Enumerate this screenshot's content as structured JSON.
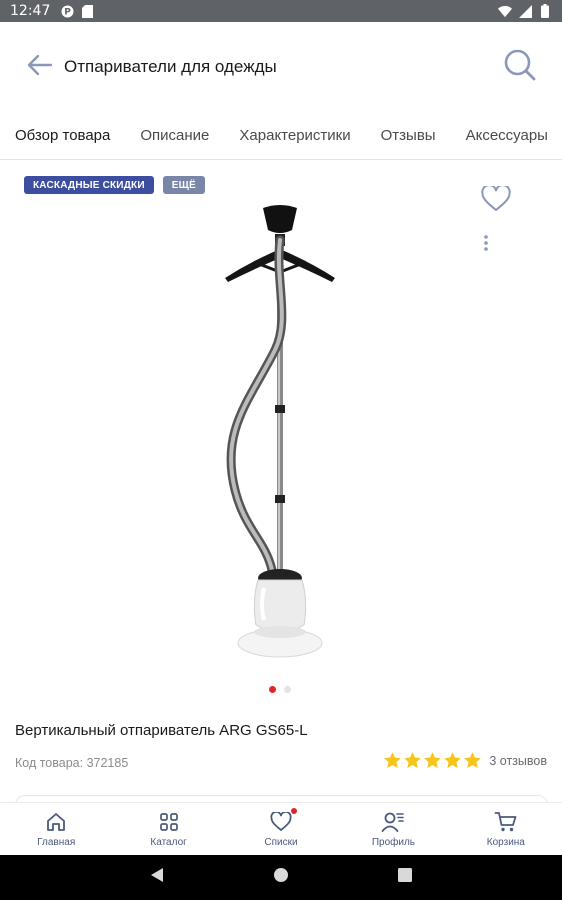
{
  "status_bar": {
    "time": "12:47",
    "icons_left": [
      "p-logo-icon",
      "sd-card-icon"
    ],
    "icons_right": [
      "wifi-icon",
      "signal-icon",
      "battery-icon"
    ]
  },
  "app_bar": {
    "title": "Отпариватели для одежды",
    "back_icon": "arrow-left-icon",
    "search_icon": "search-icon"
  },
  "tabs": [
    {
      "label": "Обзор товара",
      "active": true
    },
    {
      "label": "Описание",
      "active": false
    },
    {
      "label": "Характеристики",
      "active": false
    },
    {
      "label": "Отзывы",
      "active": false
    },
    {
      "label": "Аксессуары",
      "active": false
    }
  ],
  "badges": [
    {
      "label": "КАСКАДНЫЕ СКИДКИ"
    },
    {
      "label": "ЕЩЁ"
    }
  ],
  "gallery": {
    "current_index": 1,
    "total": 2
  },
  "product": {
    "title": "Вертикальный отпариватель ARG GS65-L",
    "code": "Код товара: 372185",
    "rating_value": 5,
    "rating_max": 5,
    "reviews_link": "3 отзывов"
  },
  "bottom_nav": [
    {
      "label": "Главная",
      "icon": "home-icon"
    },
    {
      "label": "Каталог",
      "icon": "grid-icon"
    },
    {
      "label": "Списки",
      "icon": "heart-icon",
      "badge_dot": true
    },
    {
      "label": "Профиль",
      "icon": "profile-icon"
    },
    {
      "label": "Корзина",
      "icon": "cart-icon"
    }
  ],
  "colors": {
    "accent": "#e0262a",
    "badge_primary": "#3d4ea1",
    "badge_secondary": "#7a86a8",
    "star": "#f5c518",
    "icon": "#4a5a7a"
  }
}
